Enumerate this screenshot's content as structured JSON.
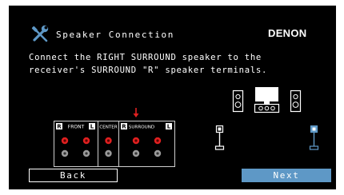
{
  "header": {
    "icon": "wrench-screwdriver-icon",
    "title": "Speaker Connection",
    "brand": "DENON"
  },
  "instruction": {
    "line1": "Connect the RIGHT SURROUND speaker to the",
    "line2": "receiver's SURROUND \"R\" speaker terminals."
  },
  "terminals": {
    "groups": [
      {
        "left_tag": "R",
        "label": "FRONT",
        "right_tag": "L"
      },
      {
        "left_tag": "",
        "label": "CENTER",
        "right_tag": ""
      },
      {
        "left_tag": "R",
        "label": "SURROUND",
        "right_tag": "L"
      }
    ],
    "highlight_arrow": "down-arrow-icon",
    "positive_color": "#e02020",
    "negative_color": "#9a9a9a"
  },
  "speaker_layout": {
    "speakers": [
      "front-left",
      "center",
      "front-right",
      "surround-left",
      "surround-right"
    ],
    "highlighted": "surround-right",
    "highlight_color": "#5e98c6"
  },
  "buttons": {
    "back": "Back",
    "next": "Next"
  },
  "colors": {
    "background": "#000000",
    "accent": "#5e98c6",
    "text": "#ffffff"
  }
}
